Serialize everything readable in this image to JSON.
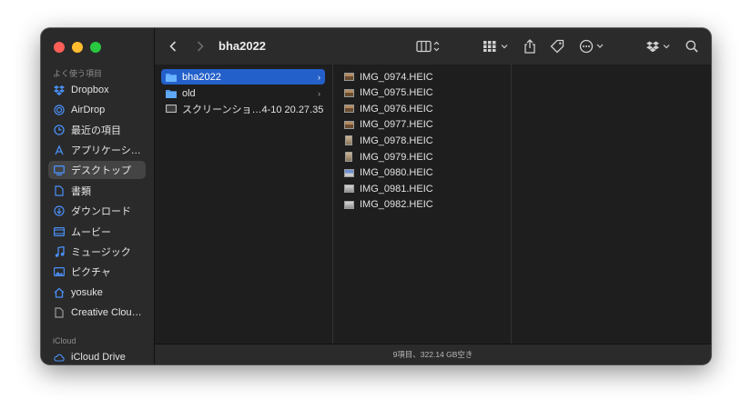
{
  "sidebar": {
    "favorites_label": "よく使う項目",
    "items": [
      {
        "label": "Dropbox",
        "icon": "dropbox-icon"
      },
      {
        "label": "AirDrop",
        "icon": "airdrop-icon"
      },
      {
        "label": "最近の項目",
        "icon": "recents-icon"
      },
      {
        "label": "アプリケーシ…",
        "icon": "applications-icon"
      },
      {
        "label": "デスクトップ",
        "icon": "desktop-icon",
        "selected": true
      },
      {
        "label": "書類",
        "icon": "documents-icon"
      },
      {
        "label": "ダウンロード",
        "icon": "downloads-icon"
      },
      {
        "label": "ムービー",
        "icon": "movies-icon"
      },
      {
        "label": "ミュージック",
        "icon": "music-icon"
      },
      {
        "label": "ピクチャ",
        "icon": "pictures-icon"
      },
      {
        "label": "yosuke",
        "icon": "home-icon"
      },
      {
        "label": "Creative Clou…",
        "icon": "document-icon"
      }
    ],
    "icloud_label": "iCloud",
    "icloud_items": [
      {
        "label": "iCloud Drive",
        "icon": "icloud-icon"
      }
    ]
  },
  "toolbar": {
    "title": "bha2022"
  },
  "columns": {
    "col1": [
      {
        "name": "bha2022",
        "kind": "folder",
        "selected": true,
        "has_children": true
      },
      {
        "name": "old",
        "kind": "folder",
        "selected": false,
        "has_children": true
      },
      {
        "name": "スクリーンショ…4-10 20.27.35",
        "kind": "screenshot",
        "selected": false,
        "has_children": false
      }
    ],
    "col2": [
      {
        "name": "IMG_0974.HEIC",
        "thumb": "land"
      },
      {
        "name": "IMG_0975.HEIC",
        "thumb": "land"
      },
      {
        "name": "IMG_0976.HEIC",
        "thumb": "land"
      },
      {
        "name": "IMG_0977.HEIC",
        "thumb": "land"
      },
      {
        "name": "IMG_0978.HEIC",
        "thumb": "port"
      },
      {
        "name": "IMG_0979.HEIC",
        "thumb": "port"
      },
      {
        "name": "IMG_0980.HEIC",
        "thumb": "blue"
      },
      {
        "name": "IMG_0981.HEIC",
        "thumb": "pale"
      },
      {
        "name": "IMG_0982.HEIC",
        "thumb": "pale"
      }
    ]
  },
  "status": {
    "text": "9項目、322.14 GB空き"
  },
  "colors": {
    "accent": "#2460c9",
    "sidebar_icon": "#4a8ff7"
  }
}
